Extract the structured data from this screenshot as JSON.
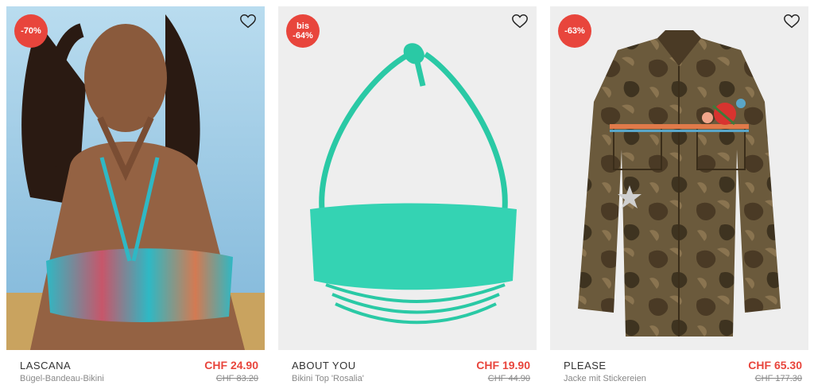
{
  "products": [
    {
      "badge": "-70%",
      "brand": "LASCANA",
      "name": "Bügel-Bandeau-Bikini",
      "price": "CHF 24.90",
      "old_price": "CHF 83.20",
      "icon": "heart-outline-icon"
    },
    {
      "badge": "bis\n-64%",
      "brand": "ABOUT YOU",
      "name": "Bikini Top 'Rosalia'",
      "price": "CHF 19.90",
      "old_price": "CHF 44.90",
      "icon": "heart-outline-icon"
    },
    {
      "badge": "-63%",
      "brand": "PLEASE",
      "name": "Jacke mit Stickereien",
      "price": "CHF 65.30",
      "old_price": "CHF 177.30",
      "icon": "heart-outline-icon"
    }
  ],
  "colors": {
    "sale": "#e8453c",
    "image_bg": "#eeeeee",
    "muted_text": "#888888",
    "brand_text": "#333333"
  }
}
